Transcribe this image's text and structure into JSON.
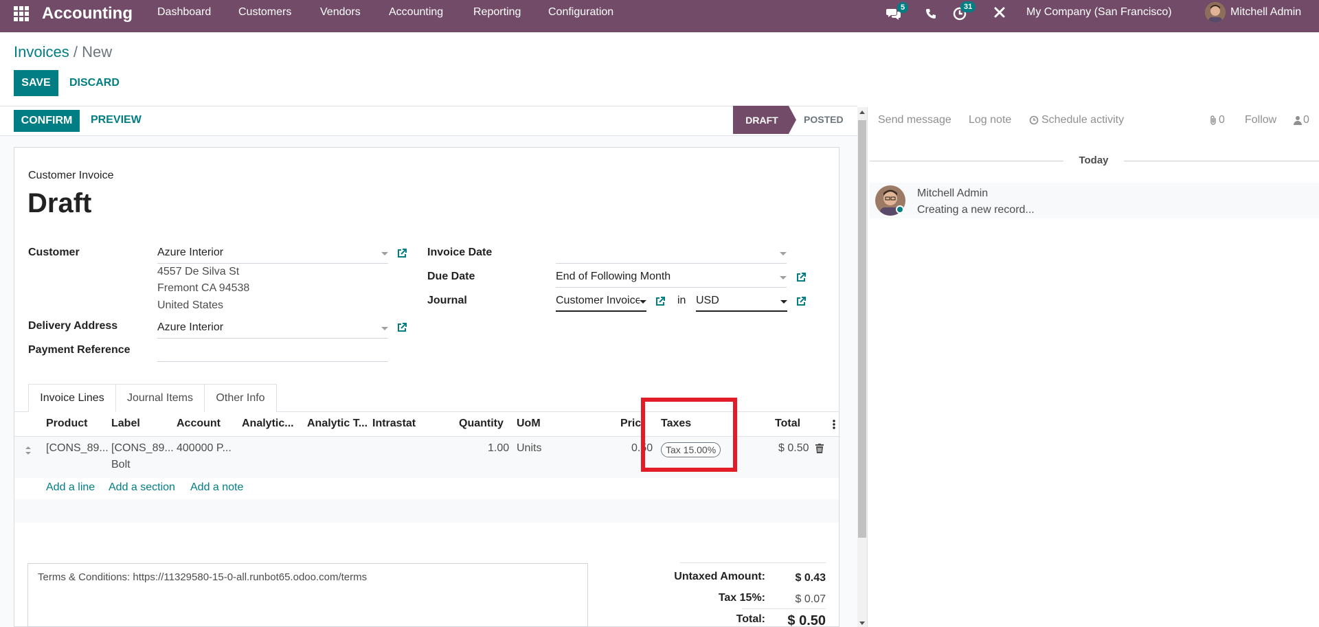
{
  "navbar": {
    "brand": "Accounting",
    "menu": [
      "Dashboard",
      "Customers",
      "Vendors",
      "Accounting",
      "Reporting",
      "Configuration"
    ],
    "messages_badge": "5",
    "activities_badge": "31",
    "company": "My Company (San Francisco)",
    "user": "Mitchell Admin",
    "icons": [
      "apps-grid-icon",
      "chat-icon",
      "phone-icon",
      "clock-icon",
      "tools-icon",
      "avatar"
    ]
  },
  "breadcrumb": {
    "parent": "Invoices",
    "separator": "/",
    "current": "New"
  },
  "control": {
    "save": "SAVE",
    "discard": "DISCARD"
  },
  "header_buttons": {
    "confirm": "CONFIRM",
    "preview": "PREVIEW"
  },
  "statusbar": {
    "stages": [
      "DRAFT",
      "POSTED"
    ],
    "active": "DRAFT"
  },
  "form": {
    "type_label": "Customer Invoice",
    "title": "Draft",
    "customer": {
      "label": "Customer",
      "value": "Azure Interior",
      "address": [
        "4557 De Silva St",
        "Fremont CA 94538",
        "United States"
      ]
    },
    "delivery_address": {
      "label": "Delivery Address",
      "value": "Azure Interior"
    },
    "payment_reference": {
      "label": "Payment Reference",
      "value": ""
    },
    "invoice_date": {
      "label": "Invoice Date",
      "value": ""
    },
    "due_date": {
      "label": "Due Date",
      "value": "End of Following Month"
    },
    "journal": {
      "label": "Journal",
      "value": "Customer Invoices",
      "in_label": "in",
      "currency": "USD"
    }
  },
  "tabs": [
    "Invoice Lines",
    "Journal Items",
    "Other Info"
  ],
  "lines": {
    "columns": [
      "Product",
      "Label",
      "Account",
      "Analytic...",
      "Analytic T...",
      "Intrastat",
      "Quantity",
      "UoM",
      "Price",
      "Taxes",
      "Total"
    ],
    "rows": [
      {
        "product": "[CONS_89...",
        "label": "[CONS_89...",
        "label_line2": "Bolt",
        "account": "400000 P...",
        "quantity": "1.00",
        "uom": "Units",
        "price": "0.50",
        "tax_tag": "Tax 15.00%",
        "total": "$ 0.50"
      }
    ],
    "add_line": "Add a line",
    "add_section": "Add a section",
    "add_note": "Add a note"
  },
  "terms": "Terms & Conditions: https://11329580-15-0-all.runbot65.odoo.com/terms",
  "totals": {
    "untaxed_label": "Untaxed Amount:",
    "untaxed_value": "$ 0.43",
    "tax_label": "Tax 15%:",
    "tax_value": "$ 0.07",
    "total_label": "Total:",
    "total_value": "$ 0.50"
  },
  "chatter": {
    "send_message": "Send message",
    "log_note": "Log note",
    "schedule_activity": "Schedule activity",
    "attachments_count": "0",
    "follow": "Follow",
    "followers_count": "0",
    "date_separator": "Today",
    "message": {
      "author": "Mitchell Admin",
      "body": "Creating a new record..."
    }
  },
  "colors": {
    "brand": "#714b67",
    "accent": "#017e84",
    "highlight": "#e31d27"
  }
}
